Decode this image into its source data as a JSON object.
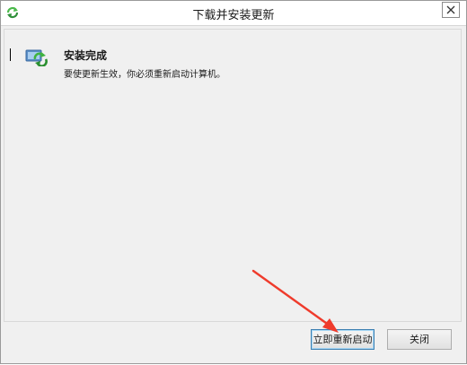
{
  "window": {
    "title": "下载并安装更新"
  },
  "content": {
    "heading": "安装完成",
    "message": "要使更新生效，你必须重新启动计算机。",
    "icon": "windows-update-icon"
  },
  "buttons": {
    "restart_label": "立即重新启动",
    "close_label": "关闭"
  },
  "colors": {
    "window_background": "#f0f0f0",
    "default_button_border": "#3c7fb1",
    "annotation_arrow": "#ef3b2c"
  }
}
